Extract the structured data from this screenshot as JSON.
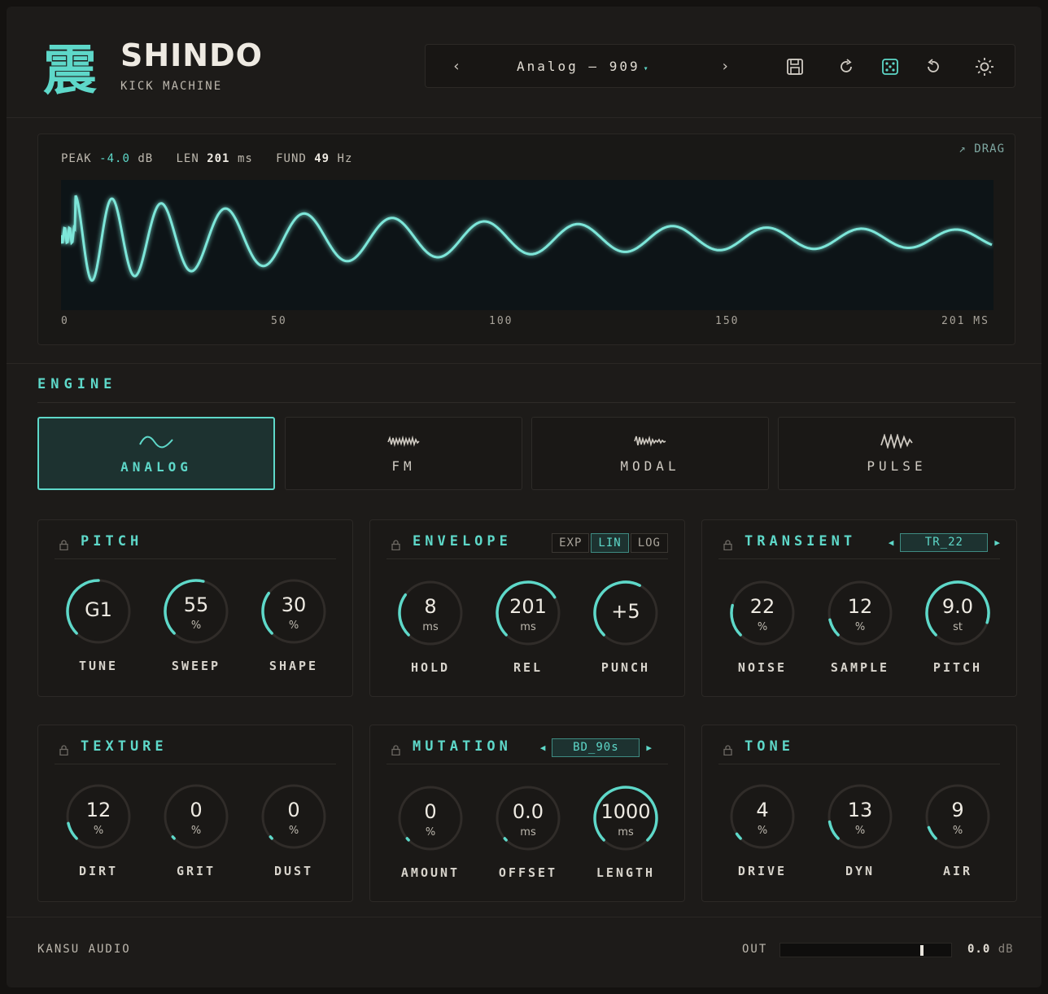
{
  "header": {
    "logo_glyph": "震",
    "title": "SHINDO",
    "subtitle": "KICK MACHINE"
  },
  "preset": {
    "prev": "‹",
    "name": "Analog – 909",
    "caret": "▾",
    "next": "›"
  },
  "toolbar": [
    "save-icon",
    "redo-icon",
    "dice-icon",
    "undo-icon",
    "sun-icon"
  ],
  "waveform": {
    "peak_label": "PEAK",
    "peak_value": "-4.0",
    "peak_unit": "dB",
    "len_label": "LEN",
    "len_value": "201",
    "len_unit": "ms",
    "fund_label": "FUND",
    "fund_value": "49",
    "fund_unit": "Hz",
    "drag_label": "↗ DRAG",
    "ticks": [
      "0",
      "50",
      "100",
      "150",
      "201 MS"
    ],
    "duration_ms": 201,
    "color": "#5ed8c9"
  },
  "engine": {
    "title": "ENGINE",
    "modes": [
      {
        "label": "ANALOG",
        "icon": "sine-wave-icon",
        "active": true
      },
      {
        "label": "FM",
        "icon": "fm-wave-icon",
        "active": false
      },
      {
        "label": "MODAL",
        "icon": "modal-wave-icon",
        "active": false
      },
      {
        "label": "PULSE",
        "icon": "pulse-wave-icon",
        "active": false
      }
    ]
  },
  "panels": {
    "pitch": {
      "title": "PITCH",
      "knobs": [
        {
          "value": "G1",
          "unit": "",
          "label": "TUNE",
          "level": 0.5
        },
        {
          "value": "55",
          "unit": "%",
          "label": "SWEEP",
          "level": 0.55
        },
        {
          "value": "30",
          "unit": "%",
          "label": "SHAPE",
          "level": 0.3
        }
      ]
    },
    "envelope": {
      "title": "ENVELOPE",
      "modes": [
        "EXP",
        "LIN",
        "LOG"
      ],
      "active_mode": "LIN",
      "knobs": [
        {
          "value": "8",
          "unit": "ms",
          "label": "HOLD",
          "level": 0.3
        },
        {
          "value": "201",
          "unit": "ms",
          "label": "REL",
          "level": 0.72
        },
        {
          "value": "+5",
          "unit": "",
          "label": "PUNCH",
          "level": 0.6
        }
      ]
    },
    "transient": {
      "title": "TRANSIENT",
      "selection": "TR_22",
      "knobs": [
        {
          "value": "22",
          "unit": "%",
          "label": "NOISE",
          "level": 0.22
        },
        {
          "value": "12",
          "unit": "%",
          "label": "SAMPLE",
          "level": 0.12
        },
        {
          "value": "9.0",
          "unit": "st",
          "label": "PITCH",
          "level": 0.9
        }
      ]
    },
    "texture": {
      "title": "TEXTURE",
      "knobs": [
        {
          "value": "12",
          "unit": "%",
          "label": "DIRT",
          "level": 0.12
        },
        {
          "value": "0",
          "unit": "%",
          "label": "GRIT",
          "level": 0
        },
        {
          "value": "0",
          "unit": "%",
          "label": "DUST",
          "level": 0
        }
      ]
    },
    "mutation": {
      "title": "MUTATION",
      "selection": "BD_90s",
      "knobs": [
        {
          "value": "0",
          "unit": "%",
          "label": "AMOUNT",
          "level": 0
        },
        {
          "value": "0.0",
          "unit": "ms",
          "label": "OFFSET",
          "level": 0
        },
        {
          "value": "1000",
          "unit": "ms",
          "label": "LENGTH",
          "level": 1.0
        }
      ]
    },
    "tone": {
      "title": "TONE",
      "knobs": [
        {
          "value": "4",
          "unit": "%",
          "label": "DRIVE",
          "level": 0.04
        },
        {
          "value": "13",
          "unit": "%",
          "label": "DYN",
          "level": 0.13
        },
        {
          "value": "9",
          "unit": "%",
          "label": "AIR",
          "level": 0.09
        }
      ]
    }
  },
  "footer": {
    "brand": "KANSU AUDIO",
    "out_label": "OUT",
    "out_value": "0.0",
    "out_unit": "dB",
    "out_level": 0.83
  },
  "colors": {
    "accent": "#5ed8c9",
    "background": "#1d1b19"
  }
}
